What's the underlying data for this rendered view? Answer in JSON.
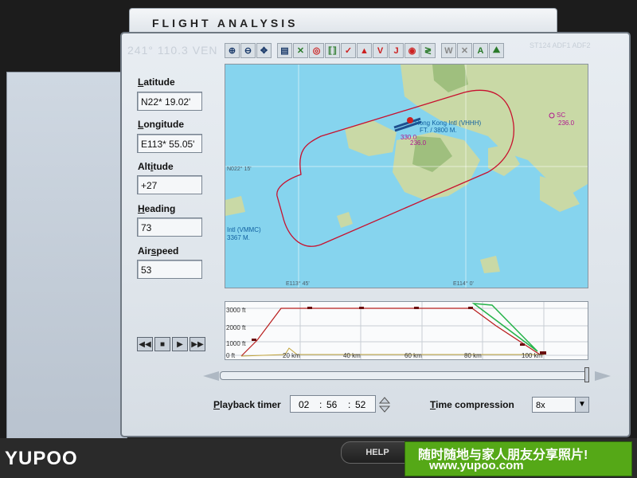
{
  "window": {
    "title": "FLIGHT ANALYSIS",
    "ghost_freq": "241° 110.3 VEN",
    "ghost_right": "ST124   ADF1    ADF2"
  },
  "fields": [
    {
      "label_pre": "",
      "label_u": "L",
      "label_post": "atitude",
      "value": "N22* 19.02'"
    },
    {
      "label_pre": "",
      "label_u": "L",
      "label_post": "ongitude",
      "value": "E113* 55.05'"
    },
    {
      "label_pre": "Alt",
      "label_u": "i",
      "label_post": "tude",
      "value": "+27"
    },
    {
      "label_pre": "",
      "label_u": "H",
      "label_post": "eading",
      "value": "73"
    },
    {
      "label_pre": "Air",
      "label_u": "s",
      "label_post": "peed",
      "value": "53"
    }
  ],
  "toolbar": {
    "icons": [
      "zoom-in-icon",
      "zoom-out-icon",
      "center-icon",
      "print-icon",
      "route-icon",
      "target-icon",
      "ndb-icon",
      "check-icon",
      "triangle-icon",
      "v-icon",
      "j-icon",
      "airport-icon",
      "airway-icon",
      "w-icon",
      "x-icon",
      "a-icon",
      "terrain-icon"
    ],
    "glyphs": [
      "⊕",
      "⊖",
      "✥",
      "▤",
      "✕",
      "◎",
      "⟦⟧",
      "✓",
      "▲",
      "V",
      "J",
      "◉",
      "≷",
      "W",
      "✕",
      "A",
      "⛰"
    ]
  },
  "map": {
    "airport1_name": "Hong Kong Intl (VHHH)",
    "airport1_elev": "FT. / 3800 M.",
    "airport1_num": "330.0",
    "airport1_num2": "236.0",
    "airport2_name": "Intl (VMMC)",
    "airport2_elev": "3367 M.",
    "vor_label": "SC",
    "vor_freq": "236.0",
    "lat_tick": "N022° 15'",
    "lon_tick1": "E113° 45'",
    "lon_tick2": "E114° 0'"
  },
  "profile": {
    "y_labels": [
      "3000 ft",
      "2000 ft",
      "1000 ft",
      "0 ft"
    ],
    "x_labels": [
      "20 km",
      "40 km",
      "60 km",
      "80 km",
      "100 km"
    ]
  },
  "playback": {
    "label_pre": "",
    "label_u": "P",
    "label_post": "layback timer",
    "hh": "02",
    "mm": "56",
    "ss": "52"
  },
  "time_compression": {
    "label_u": "T",
    "label_post": "ime compression",
    "value": "8x"
  },
  "bottom": {
    "help": "HELP",
    "banner_line1": "随时随地与家人朋友分享照片!",
    "banner_line2": "www.yupoo.com",
    "logo": "YUPOO"
  },
  "colors": {
    "sea": "#86d4ee",
    "land": "#c9d9a6",
    "route": "#c8102e",
    "profile_line": "#b81c1c"
  }
}
